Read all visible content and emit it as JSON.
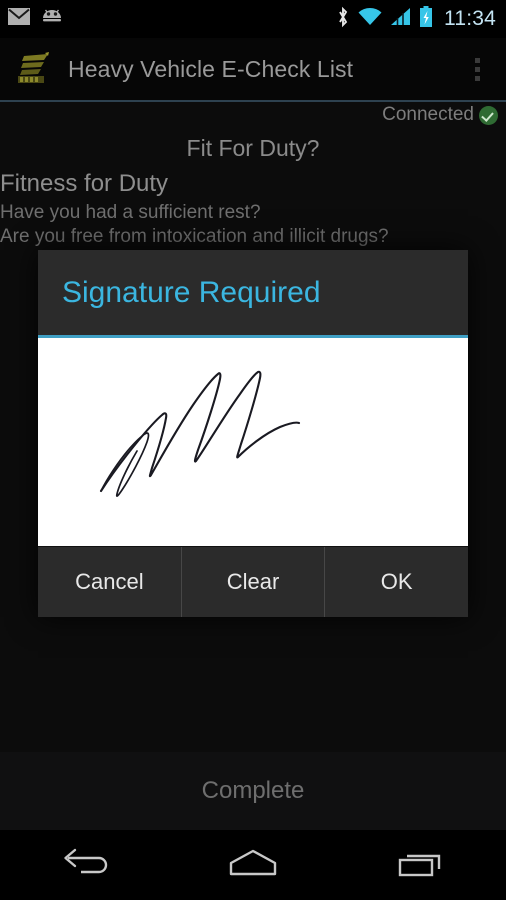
{
  "status_bar": {
    "notifications": [
      {
        "icon": "mail-icon"
      },
      {
        "icon": "android-robot-icon"
      }
    ],
    "system_icons": [
      {
        "icon": "bluetooth-icon"
      },
      {
        "icon": "wifi-icon"
      },
      {
        "icon": "cellular-signal-icon"
      },
      {
        "icon": "battery-charging-icon"
      }
    ],
    "time": "11:34",
    "time_color": "#c3e3f2"
  },
  "action_bar": {
    "app_logo": "app-logo-icon",
    "title": "Heavy Vehicle E-Check List",
    "overflow": "overflow-menu-icon",
    "divider_color": "#2e4250"
  },
  "content": {
    "connection": {
      "label": "Connected",
      "icon": "check-circle-icon",
      "color": "#2f6b33"
    },
    "section_heading": "Fit For Duty?",
    "group_title": "Fitness for Duty",
    "questions": [
      "Have you had a sufficient rest?",
      "Are you free from intoxication and illicit drugs?"
    ]
  },
  "dialog": {
    "title": "Signature Required",
    "title_color": "#3bb6e0",
    "accent_color": "#3f9fc4",
    "canvas": {
      "name": "signature-pad",
      "background": "#ffffff",
      "ink_color": "#1a1a22",
      "signed": true
    },
    "buttons": [
      {
        "label": "Cancel",
        "name": "cancel-button"
      },
      {
        "label": "Clear",
        "name": "clear-button"
      },
      {
        "label": "OK",
        "name": "ok-button"
      }
    ]
  },
  "footer": {
    "complete_label": "Complete"
  },
  "nav_bar": {
    "buttons": [
      {
        "name": "nav-back-button",
        "icon": "back-arrow-icon"
      },
      {
        "name": "nav-home-button",
        "icon": "home-icon"
      },
      {
        "name": "nav-recents-button",
        "icon": "recents-icon"
      }
    ]
  }
}
